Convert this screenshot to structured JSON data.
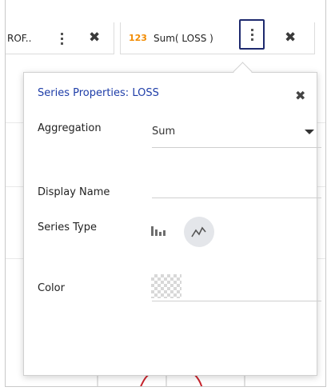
{
  "chip_bar": {
    "prev_chip": {
      "label": "ROF.."
    },
    "active_chip": {
      "type_badge": "123",
      "label": "Sum( LOSS )"
    }
  },
  "popover": {
    "title": "Series Properties: LOSS",
    "fields": {
      "aggregation": {
        "label": "Aggregation",
        "value": "Sum"
      },
      "display_name": {
        "label": "Display Name",
        "value": ""
      },
      "series_type": {
        "label": "Series Type",
        "options": [
          "bar-chart-icon",
          "line-chart-icon"
        ],
        "selected": "line-chart-icon"
      },
      "color": {
        "label": "Color",
        "value": ""
      }
    }
  },
  "colors": {
    "title": "#1e3da8",
    "type_badge": "#f28b00",
    "active_outline": "#1e2a6e",
    "chart_curve": "#c8232c"
  }
}
